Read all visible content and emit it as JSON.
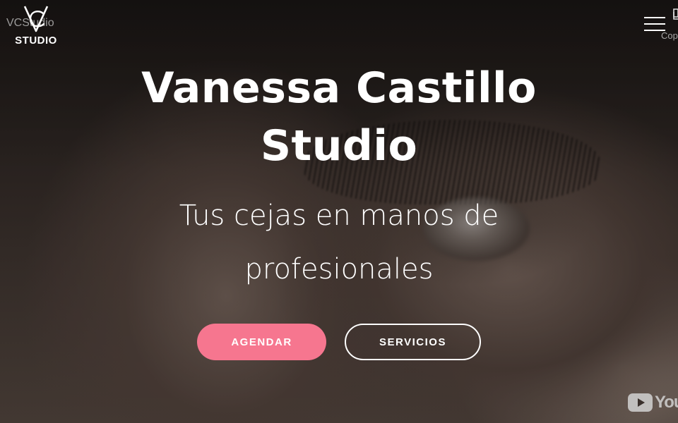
{
  "header": {
    "logo_letters": "VC",
    "logo_word": "STUDIO",
    "logo_alt_text": "VCStudio",
    "corner_label": "Cop"
  },
  "hero": {
    "title_line1": "Vanessa Castillo",
    "title_line2": "Studio",
    "subtitle_line1": "Tus cejas en manos de",
    "subtitle_line2": "profesionales"
  },
  "actions": {
    "primary_label": "AGENDAR",
    "secondary_label": "SERVICIOS"
  },
  "video": {
    "brand_text": "YouT"
  },
  "colors": {
    "accent": "#f6768f",
    "text": "#ffffff"
  },
  "icons": {
    "menu": "hamburger-icon",
    "logo": "vc-monogram-icon",
    "youtube": "youtube-play-icon"
  }
}
